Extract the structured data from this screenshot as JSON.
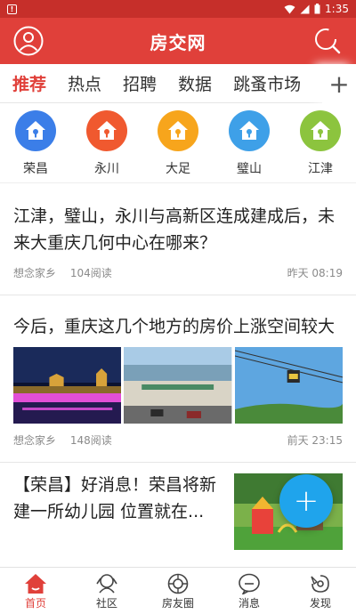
{
  "status_bar": {
    "warning": "!",
    "time": "1:35"
  },
  "app_bar": {
    "title": "房交网"
  },
  "tabs": [
    "推荐",
    "热点",
    "招聘",
    "数据",
    "跳蚤市场"
  ],
  "tabs_plus": "+",
  "districts": [
    {
      "label": "荣昌",
      "color": "#3b7ee8"
    },
    {
      "label": "永川",
      "color": "#f0592f"
    },
    {
      "label": "大足",
      "color": "#f7a51c"
    },
    {
      "label": "璧山",
      "color": "#3ea0e8"
    },
    {
      "label": "江津",
      "color": "#8cc43e"
    }
  ],
  "articles": [
    {
      "title": "江津，璧山，永川与高新区连成建成后，未来大重庆几何中心在哪来？",
      "author": "想念家乡",
      "reads": "104阅读",
      "time": "昨天 08:19"
    },
    {
      "title": "今后，重庆这几个地方的房价上涨空间较大",
      "author": "想念家乡",
      "reads": "148阅读",
      "time": "前天 23:15"
    },
    {
      "title": "【荣昌】好消息！荣昌将新建一所幼儿园 位置就在..."
    }
  ],
  "fab_label": "+",
  "bottom_nav": [
    {
      "label": "首页",
      "icon": "home-icon"
    },
    {
      "label": "社区",
      "icon": "community-icon"
    },
    {
      "label": "房友圈",
      "icon": "moments-icon"
    },
    {
      "label": "消息",
      "icon": "message-icon"
    },
    {
      "label": "发现",
      "icon": "discover-icon"
    }
  ],
  "colors": {
    "brand": "#e0403a",
    "status": "#c62f2a",
    "fab": "#1fa4ec"
  }
}
